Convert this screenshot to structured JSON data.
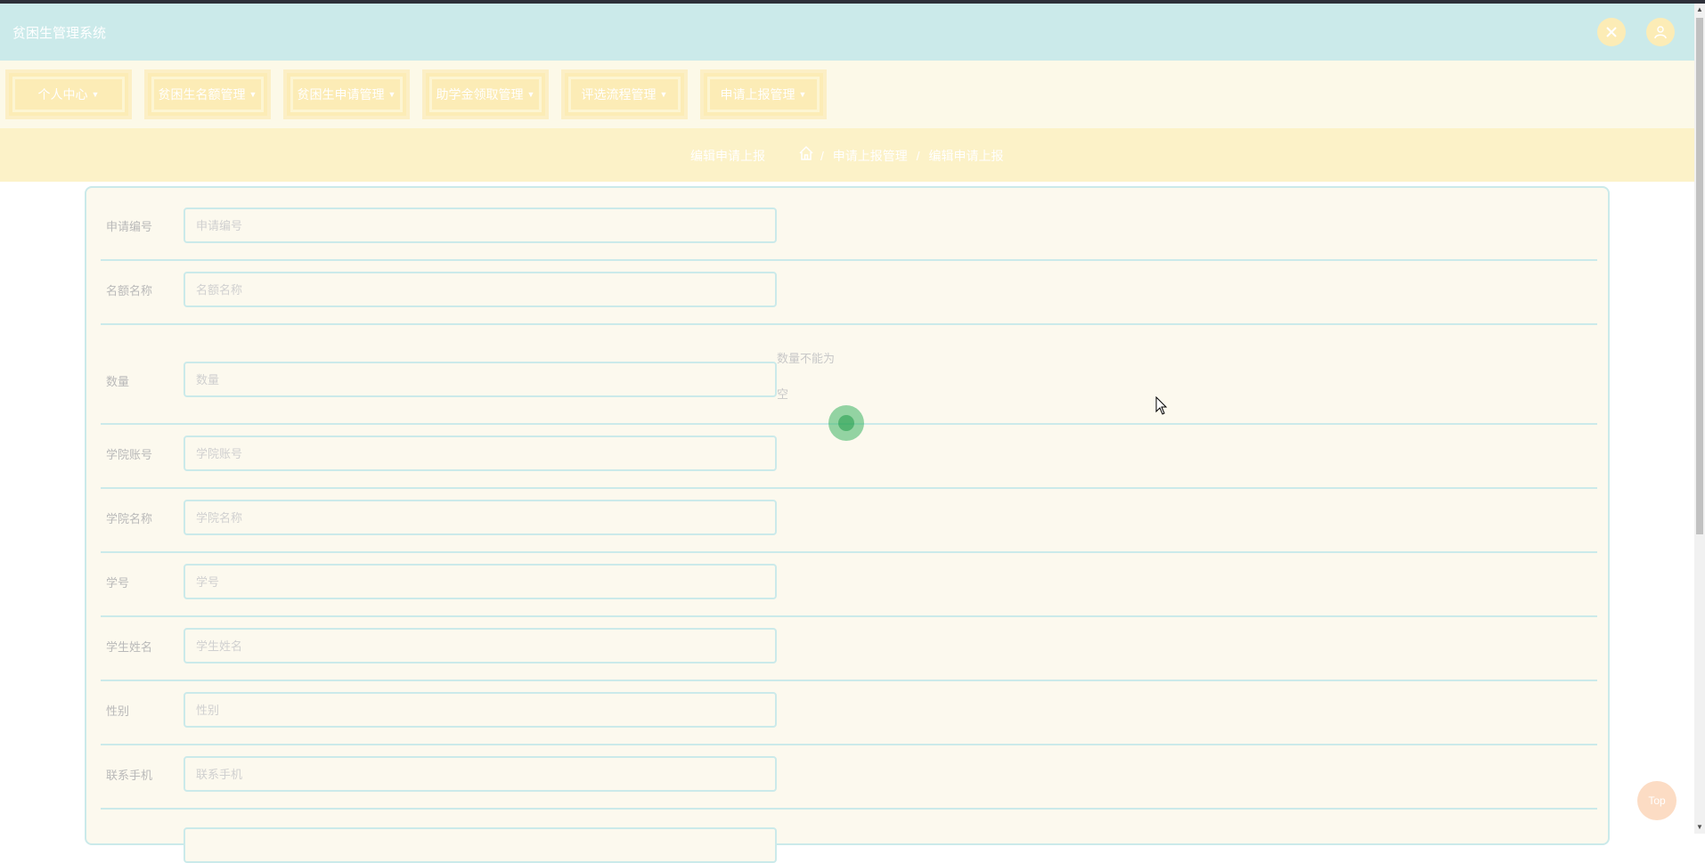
{
  "app": {
    "title": "贫困生管理系统"
  },
  "header": {
    "icons": [
      "share-icon",
      "user-icon"
    ]
  },
  "nav": {
    "items": [
      {
        "label": "个人中心"
      },
      {
        "label": "贫困生名额管理"
      },
      {
        "label": "贫困生申请管理"
      },
      {
        "label": "助学金领取管理"
      },
      {
        "label": "评选流程管理"
      },
      {
        "label": "申请上报管理"
      }
    ]
  },
  "breadcrumb": {
    "current": "编辑申请上报",
    "path": [
      "申请上报管理",
      "编辑申请上报"
    ],
    "separator": "/"
  },
  "form": {
    "fields": [
      {
        "label": "申请编号",
        "placeholder": "申请编号",
        "value": ""
      },
      {
        "label": "名额名称",
        "placeholder": "名额名称",
        "value": ""
      },
      {
        "label": "数量",
        "placeholder": "数量",
        "value": "",
        "error": "数量不能为空"
      },
      {
        "label": "学院账号",
        "placeholder": "学院账号",
        "value": ""
      },
      {
        "label": "学院名称",
        "placeholder": "学院名称",
        "value": ""
      },
      {
        "label": "学号",
        "placeholder": "学号",
        "value": ""
      },
      {
        "label": "学生姓名",
        "placeholder": "学生姓名",
        "value": ""
      },
      {
        "label": "性别",
        "placeholder": "性别",
        "value": ""
      },
      {
        "label": "联系手机",
        "placeholder": "联系手机",
        "value": ""
      }
    ]
  },
  "back_to_top": {
    "label": "Top"
  },
  "colors": {
    "header_bg": "#cbeaea",
    "nav_bg": "#fcf9e8",
    "nav_button": "#fcecb6",
    "breadcrumb_bg": "#fcf2c8",
    "form_bg": "#fcf9ee",
    "border": "#cbeaea",
    "top_button": "#fcdcc4"
  }
}
